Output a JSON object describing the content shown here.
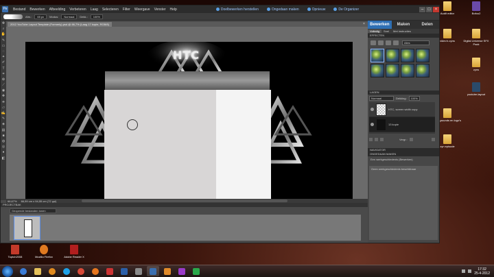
{
  "menubar": {
    "items": [
      "Bestand",
      "Bewerken",
      "Afbeelding",
      "Verbeteren",
      "Laag",
      "Selecteren",
      "Filter",
      "Weergave",
      "Venster",
      "Help"
    ],
    "undo_label": "Doelbewerken herstellen",
    "create_label": "Ongedaan maken",
    "redo_label": "Opnieuw",
    "organizer_label": "De Organizer"
  },
  "options": {
    "size_label": "Afm.:",
    "size_value": "65 px",
    "mode_label": "Modus:",
    "mode_value": "Normaal",
    "opacity_label": "Dekk.:",
    "opacity_value": "100%"
  },
  "document": {
    "tab_title": "2012 YouTube Layout Template (Formerly).psd @ 66,7% (Laag 17 kopie, RGB/8)"
  },
  "canvas": {
    "logo_text": "HTC"
  },
  "status": {
    "zoom": "66,67%",
    "dimensions": "66,99 cm x 94,55 cm (72 ppi)"
  },
  "project_bin": {
    "header": "PROJECTBAK",
    "dropdown": "Geopende bestanden tonen"
  },
  "right_panel": {
    "tabs": [
      "Bewerken",
      "Maken",
      "Delen"
    ],
    "sub_tabs": [
      "Volledig",
      "Snel",
      "Met instructies"
    ],
    "effects_header": "EFFECTEN",
    "effects_filter": "Alles",
    "layers_header": "LAGEN",
    "blend_mode": "Normaal",
    "opacity_label": "Dekking:",
    "opacity_value": "100%",
    "layers": [
      {
        "name": "HTC, screen width copy"
      },
      {
        "name": "13 kopie"
      }
    ],
    "lock_label": "Vergr.:",
    "navigator_header": "NAVIGATOR",
    "history_header": "ONGEDAAN MAKEN",
    "history_items": [
      "Een werkgeschiedenis (Bewerken)",
      "Geen werkgeschiedenis beschikbaar"
    ]
  },
  "desktop_icons": [
    {
      "label": "Audit editor"
    },
    {
      "label": "Bofoo2"
    },
    {
      "label": "video's zyns"
    },
    {
      "label": "Digital Universe SFX Pack"
    },
    {
      "label": "zyns"
    },
    {
      "label": "youtube-layout"
    },
    {
      "label": "backgrounds en logo's"
    },
    {
      "label": "zyn episode"
    },
    {
      "label": "Toptch2008"
    },
    {
      "label": "Mozilla Firefox"
    },
    {
      "label": "Adobe Reader X"
    }
  ],
  "taskbar": {
    "time": "17:32",
    "date": "25-4-2012"
  }
}
